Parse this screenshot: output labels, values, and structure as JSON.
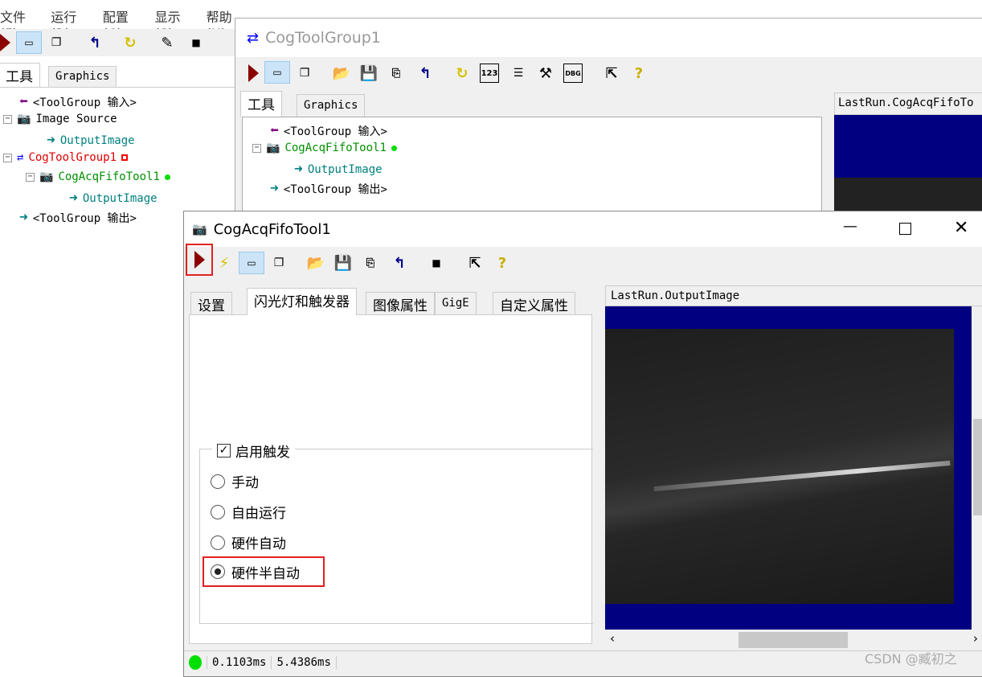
{
  "main_window": {
    "menu": [
      "文件(F)",
      "运行(R)",
      "配置(C)",
      "显示(S)",
      "帮助(H)"
    ],
    "tabs": [
      "工具",
      "Graphics"
    ],
    "tree": [
      {
        "label": "<ToolGroup 输入>",
        "icon": "input-arrow-icon"
      },
      {
        "label": "Image Source",
        "icon": "camera-icon"
      },
      {
        "label": "OutputImage",
        "icon": "output-arrow-icon"
      },
      {
        "label": "CogToolGroup1",
        "icon": "toolgroup-icon"
      },
      {
        "label": "CogAcqFifoTool1",
        "icon": "camera-icon"
      },
      {
        "label": "OutputImage",
        "icon": "output-arrow-icon"
      },
      {
        "label": "<ToolGroup 输出>",
        "icon": "output-arrow-icon"
      }
    ]
  },
  "group_window": {
    "title": "CogToolGroup1",
    "tabs": [
      "工具",
      "Graphics"
    ],
    "tree": [
      {
        "label": "<ToolGroup 输入>"
      },
      {
        "label": "CogAcqFifoTool1"
      },
      {
        "label": "OutputImage"
      },
      {
        "label": "<ToolGroup 输出>"
      }
    ],
    "image_header": "LastRun.CogAcqFifoTo"
  },
  "tool_window": {
    "title": "CogAcqFifoTool1",
    "tabs": [
      "设置",
      "闪光灯和触发器",
      "图像属性",
      "GigE",
      "自定义属性"
    ],
    "active_tab": 1,
    "trigger": {
      "enable_label": "启用触发",
      "enabled": true,
      "options": [
        "手动",
        "自由运行",
        "硬件自动",
        "硬件半自动"
      ],
      "selected": 3
    },
    "image_header": "LastRun.OutputImage",
    "status": {
      "time1": "0.1103ms",
      "time2": "5.4386ms",
      "status_color": "#00e000"
    }
  },
  "watermark": "CSDN @臧初之",
  "colors": {
    "highlight": "#e02020",
    "navy": "#000080"
  }
}
